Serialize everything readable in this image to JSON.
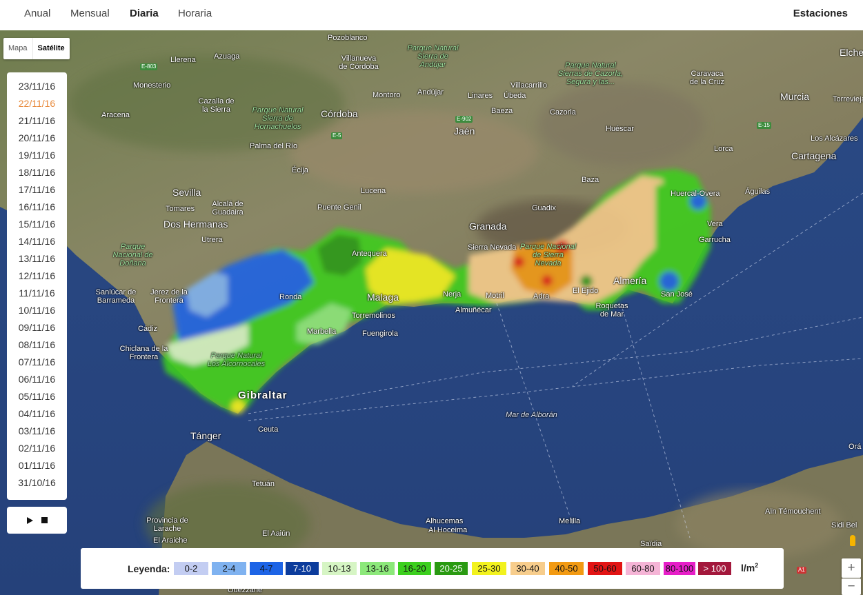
{
  "nav": {
    "tabs": [
      {
        "label": "Anual",
        "active": false
      },
      {
        "label": "Mensual",
        "active": false
      },
      {
        "label": "Diaria",
        "active": true
      },
      {
        "label": "Horaria",
        "active": false
      }
    ],
    "stations_label": "Estaciones"
  },
  "map_type": {
    "map_label": "Mapa",
    "satellite_label": "Satélite",
    "selected": "Satélite"
  },
  "dates": {
    "selected": "22/11/16",
    "items": [
      "23/11/16",
      "22/11/16",
      "21/11/16",
      "20/11/16",
      "19/11/16",
      "18/11/16",
      "17/11/16",
      "16/11/16",
      "15/11/16",
      "14/11/16",
      "13/11/16",
      "12/11/16",
      "11/11/16",
      "10/11/16",
      "09/11/16",
      "08/11/16",
      "07/11/16",
      "06/11/16",
      "05/11/16",
      "04/11/16",
      "03/11/16",
      "02/11/16",
      "01/11/16",
      "31/10/16"
    ]
  },
  "player": {
    "play_icon": "play-icon",
    "stop_icon": "stop-icon"
  },
  "legend": {
    "title": "Leyenda:",
    "unit": "l/m",
    "unit_exp": "2",
    "items": [
      {
        "label": "0-2",
        "color": "#c3cdf2"
      },
      {
        "label": "2-4",
        "color": "#7fb2f0"
      },
      {
        "label": "4-7",
        "color": "#1d64e6"
      },
      {
        "label": "7-10",
        "color": "#0c3c9c"
      },
      {
        "label": "10-13",
        "color": "#d6f5c4"
      },
      {
        "label": "13-16",
        "color": "#8ce87a"
      },
      {
        "label": "16-20",
        "color": "#3ccf1e"
      },
      {
        "label": "20-25",
        "color": "#2a9a12"
      },
      {
        "label": "25-30",
        "color": "#f2f21e"
      },
      {
        "label": "30-40",
        "color": "#f7cd8c"
      },
      {
        "label": "40-50",
        "color": "#f29a12"
      },
      {
        "label": "50-60",
        "color": "#e21414"
      },
      {
        "label": "60-80",
        "color": "#f5b4d6"
      },
      {
        "label": "80-100",
        "color": "#e61ec8"
      },
      {
        "label": "> 100",
        "color": "#a3183c"
      }
    ]
  },
  "map_labels": {
    "cities": [
      "Sevilla",
      "Córdoba",
      "Granada",
      "Jaén",
      "Malaga",
      "Almería",
      "Murcia",
      "Cartagena",
      "Cádiz",
      "Gibraltar",
      "Tánger",
      "Ceuta",
      "Tetuán",
      "Melilla",
      "Motril",
      "Marbella",
      "Fuengirola",
      "Torremolinos",
      "Ronda",
      "Antequera",
      "Lucena",
      "Puente Genil",
      "Écija",
      "Palma del Río",
      "Montoro",
      "Andújar",
      "Linares",
      "Úbeda",
      "Baeza",
      "Guadix",
      "Baza",
      "Huéscar",
      "Lorca",
      "Águilas",
      "Huercal-Overa",
      "Vera",
      "Garrucha",
      "El Ejido",
      "Adra",
      "Nerja",
      "Almuñécar",
      "Roquetas de Mar",
      "Dos Hermanas",
      "Utrera",
      "Alcalá de Guadaira",
      "Tomares",
      "Jerez de la Frontera",
      "Sanlúcar de Barrameda",
      "Chiclana de la Frontera",
      "Pozoblanco",
      "Villanueva de Córdoba",
      "Aracena",
      "Monesterio",
      "Cazalla de la Sierra",
      "Azuaga",
      "Llerena",
      "Villacarrillo",
      "Caravaca de la Cruz",
      "Cazorla",
      "Elche",
      "Torrevieja",
      "Los Alcázares",
      "Sierra Nevada",
      "San José",
      "Alhucemas",
      "Al Hoceima",
      "Provincia de Larache",
      "El Araiche",
      "Ouezzane",
      "El Aaiún",
      "Saïdia",
      "Aïn Témouchent",
      "Sidi Bel",
      "Orá"
    ],
    "parks": [
      "Parque Natural Sierra de Andújar",
      "Parque Natural Sierras de Cazorla, Segura y las...",
      "Parque Natural Sierra de Hornachuelos",
      "Parque Nacional de Doñana",
      "Parque Natural Los Alcornocales",
      "Parque Nacional de Sierra Nevada"
    ],
    "roads": [
      "E-803",
      "E-5",
      "E-902",
      "E-15",
      "A1"
    ],
    "sea": "Mar de Alborán"
  },
  "controls": {
    "zoom_in": "+",
    "zoom_out": "−",
    "pegman_icon": "pegman-icon"
  }
}
